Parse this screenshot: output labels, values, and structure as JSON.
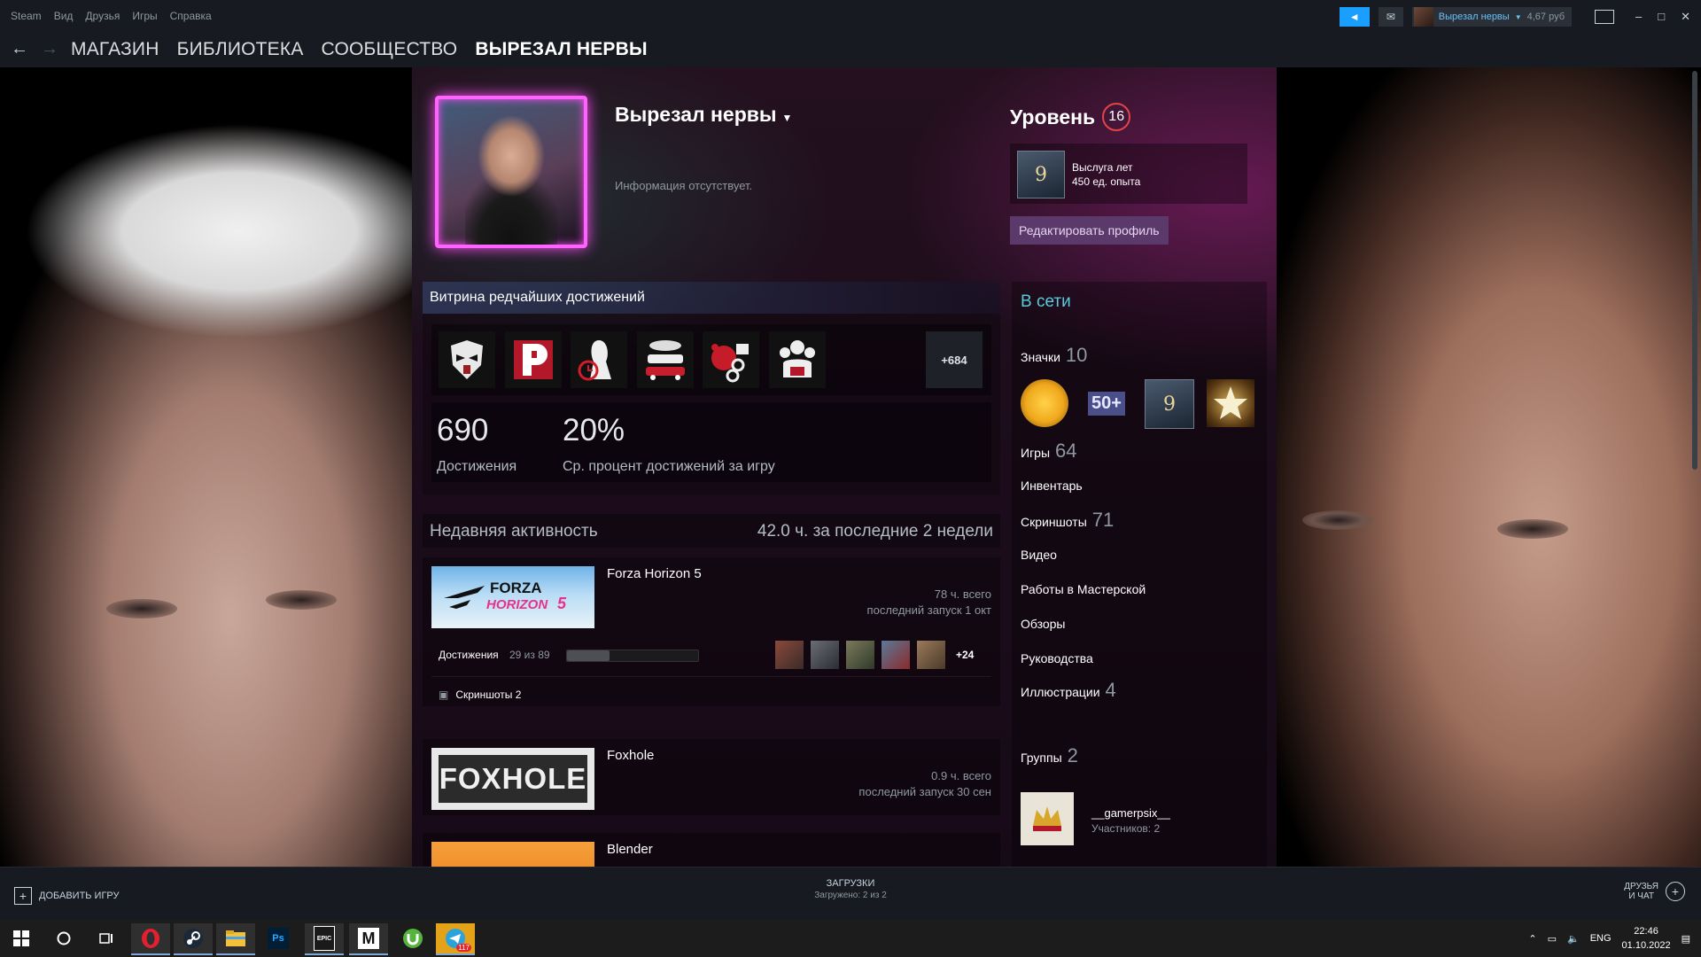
{
  "menu": [
    "Steam",
    "Вид",
    "Друзья",
    "Игры",
    "Справка"
  ],
  "account": {
    "name": "Вырезал нервы",
    "balance": "4,67 руб"
  },
  "nav": {
    "links": [
      {
        "label": "МАГАЗИН",
        "active": false
      },
      {
        "label": "БИБЛИОТЕКА",
        "active": false
      },
      {
        "label": "СООБЩЕСТВО",
        "active": false
      },
      {
        "label": "ВЫРЕЗАЛ НЕРВЫ",
        "active": true
      }
    ]
  },
  "profile": {
    "name": "Вырезал нервы",
    "info": "Информация отсутствует.",
    "level_label": "Уровень",
    "level": "16",
    "years_badge": {
      "glyph": "9",
      "title": "Выслуга лет",
      "xp": "450 ед. опыта"
    },
    "edit_button": "Редактировать профиль"
  },
  "showcase": {
    "title": "Витрина редчайших достижений",
    "icons": [
      "mask-achievement-icon",
      "letter-p-achievement-icon",
      "clock-figure-achievement-icon",
      "cars-achievement-icon",
      "handcuffs-achievement-icon",
      "team-achievement-icon"
    ],
    "more": "+684",
    "achievements_count": "690",
    "achievements_label": "Достижения",
    "avg_percent": "20%",
    "avg_label": "Ср. процент достижений за игру"
  },
  "recent": {
    "title": "Недавняя активность",
    "summary": "42.0 ч. за последние 2 недели",
    "games": [
      {
        "name": "Forza Horizon 5",
        "hours": "78 ч. всего",
        "last": "последний запуск 1 окт",
        "ach_label": "Достижения",
        "ach_count": "29 из 89",
        "ach_progress": 0.326,
        "ach_more": "+24",
        "shots": "Скриншоты 2"
      },
      {
        "name": "Foxhole",
        "hours": "0.9 ч. всего",
        "last": "последний запуск 30 сен",
        "capsule_text": "FOXHOLE"
      },
      {
        "name": "Blender"
      }
    ]
  },
  "sidebar": {
    "status": "В сети",
    "badges_label": "Значки",
    "badges_count": "10",
    "badge_icons": [
      "gold-coin-badge-icon",
      "50-plus-badge-icon",
      "years-badge-icon",
      "star-badge-icon"
    ],
    "badge_50": "50+",
    "badge_9": "9",
    "games_label": "Игры",
    "games_count": "64",
    "inventory": "Инвентарь",
    "screenshots_label": "Скриншоты",
    "screenshots_count": "71",
    "video": "Видео",
    "workshop": "Работы в Мастерской",
    "reviews": "Обзоры",
    "guides": "Руководства",
    "art_label": "Иллюстрации",
    "art_count": "4",
    "groups_label": "Группы",
    "groups_count": "2",
    "group": {
      "name": "__gamerpsix__",
      "members": "Участников: 2"
    }
  },
  "bottom": {
    "add_game": "ДОБАВИТЬ ИГРУ",
    "downloads": "ЗАГРУЗКИ",
    "downloads_status": "Загружено: 2 из 2",
    "friends_1": "ДРУЗЬЯ",
    "friends_2": "И ЧАТ"
  },
  "taskbar": {
    "apps": [
      "opera-icon",
      "steam-icon",
      "explorer-icon",
      "photoshop-icon",
      "epic-games-icon",
      "m-app-icon",
      "utorrent-icon",
      "telegram-icon"
    ],
    "ps": "Ps",
    "epic": "EPIC",
    "m": "M",
    "telegram_badge": "117",
    "lang": "ENG",
    "time": "22:46",
    "date": "01.10.2022"
  }
}
